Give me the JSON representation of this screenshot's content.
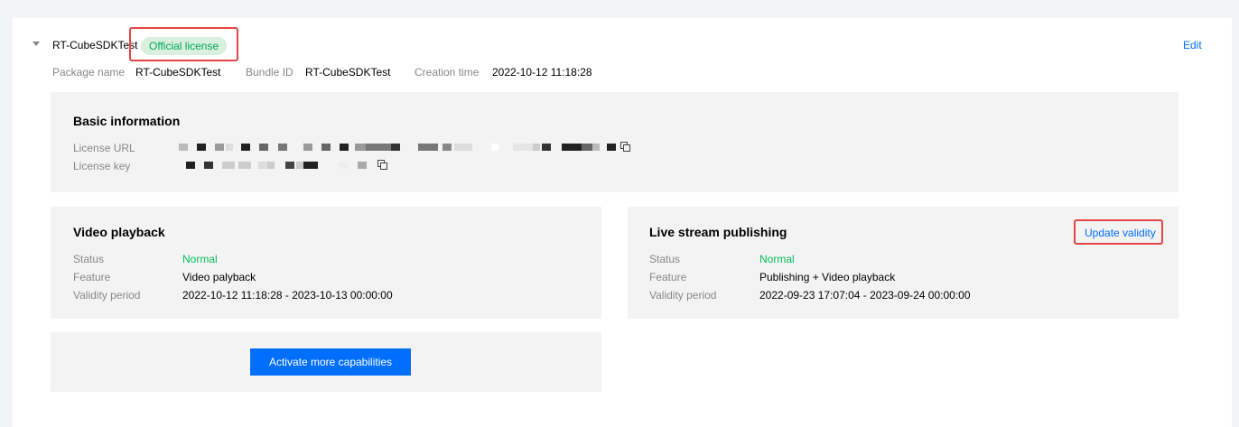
{
  "package": {
    "title": "RT-CubeSDKTest",
    "badge": "Official license",
    "edit_label": "Edit",
    "package_name_label": "Package name",
    "package_name": "RT-CubeSDKTest",
    "bundle_id_label": "Bundle ID",
    "bundle_id": "RT-CubeSDKTest",
    "creation_time_label": "Creation time",
    "creation_time": "2022-10-12 11:18:28"
  },
  "basic_info": {
    "title": "Basic information",
    "license_url_label": "License URL",
    "license_key_label": "License key",
    "license_url_value": "",
    "license_key_value": ""
  },
  "video_playback": {
    "title": "Video playback",
    "status_label": "Status",
    "status": "Normal",
    "feature_label": "Feature",
    "feature": "Video palyback",
    "validity_label": "Validity period",
    "validity": "2022-10-12 11:18:28 - 2023-10-13 00:00:00"
  },
  "live_stream": {
    "title": "Live stream publishing",
    "update_label": "Update validity",
    "status_label": "Status",
    "status": "Normal",
    "feature_label": "Feature",
    "feature": "Publishing + Video playback",
    "validity_label": "Validity period",
    "validity": "2022-09-23 17:07:04 - 2023-09-24 00:00:00"
  },
  "activate_button_label": "Activate more capabilities",
  "colors": {
    "accent": "#006eff",
    "status_ok": "#0abf5b",
    "badge_bg": "#d8f0dd",
    "highlight": "#e54545"
  }
}
